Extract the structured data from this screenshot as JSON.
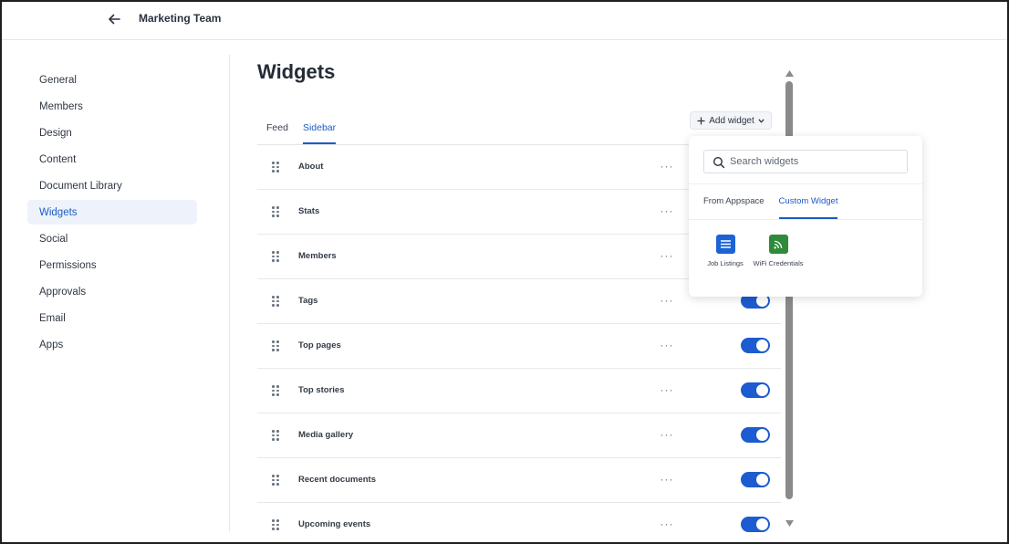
{
  "header": {
    "title": "Marketing Team",
    "back_icon": "arrow-left-icon"
  },
  "nav": {
    "items": [
      {
        "label": "General"
      },
      {
        "label": "Members"
      },
      {
        "label": "Design"
      },
      {
        "label": "Content"
      },
      {
        "label": "Document Library"
      },
      {
        "label": "Widgets",
        "active": true
      },
      {
        "label": "Social"
      },
      {
        "label": "Permissions"
      },
      {
        "label": "Approvals"
      },
      {
        "label": "Email"
      },
      {
        "label": "Apps"
      }
    ]
  },
  "main": {
    "title": "Widgets",
    "tabs": [
      {
        "label": "Feed"
      },
      {
        "label": "Sidebar",
        "active": true
      }
    ],
    "add_widget_label": "Add widget",
    "widgets": [
      {
        "label": "About"
      },
      {
        "label": "Stats"
      },
      {
        "label": "Members"
      },
      {
        "label": "Tags",
        "enabled": true
      },
      {
        "label": "Top pages",
        "enabled": true
      },
      {
        "label": "Top stories",
        "enabled": true
      },
      {
        "label": "Media gallery",
        "enabled": true
      },
      {
        "label": "Recent documents",
        "enabled": true
      },
      {
        "label": "Upcoming events",
        "enabled": true
      }
    ],
    "more_label": "···"
  },
  "popup": {
    "search_placeholder": "Search widgets",
    "tabs": [
      {
        "label": "From Appspace"
      },
      {
        "label": "Custom Widget",
        "active": true
      }
    ],
    "items": [
      {
        "label": "Job Listings",
        "icon": "list-icon",
        "color": "#1c63d6"
      },
      {
        "label": "WiFi Credentials",
        "icon": "rss-icon",
        "color": "#2f8a3a"
      }
    ]
  },
  "colors": {
    "accent": "#1c5bc4",
    "toggle_on": "#1c5bd0"
  }
}
